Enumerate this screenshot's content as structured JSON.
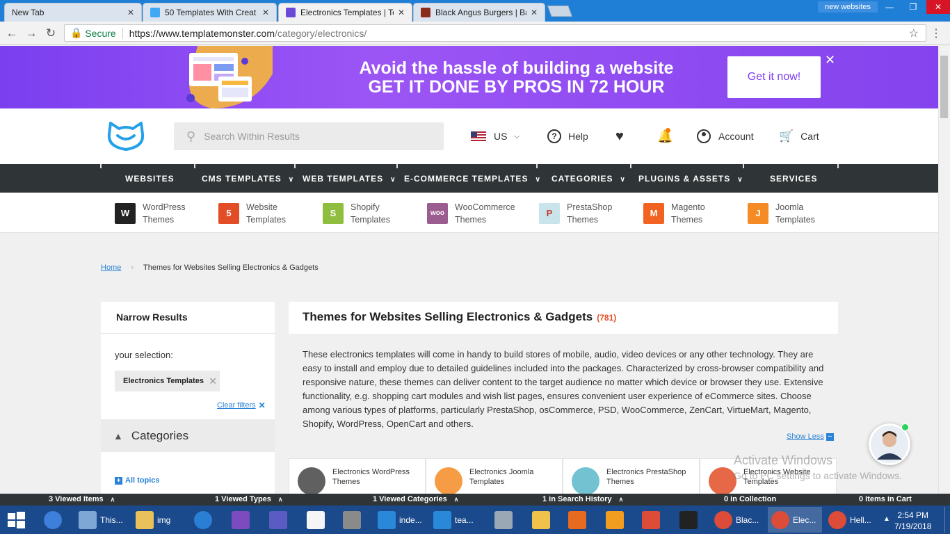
{
  "browser": {
    "tabs": [
      {
        "title": "New Tab",
        "active": false
      },
      {
        "title": "50 Templates With Creat",
        "active": false
      },
      {
        "title": "Electronics Templates | Te",
        "active": true
      },
      {
        "title": "Black Angus Burgers | Bac",
        "active": false
      }
    ],
    "profile": "new websites",
    "secure_label": "Secure",
    "url_host": "https://www.templatemonster.com",
    "url_path": "/category/electronics/"
  },
  "banner": {
    "line1": "Avoid the hassle of building a website",
    "line2": "GET IT DONE BY PROS IN 72 HOUR",
    "cta": "Get it now!"
  },
  "header": {
    "search_placeholder": "Search Within Results",
    "locale": "US",
    "help": "Help",
    "account": "Account",
    "cart": "Cart"
  },
  "nav": [
    {
      "label": "WEBSITES",
      "dropdown": false
    },
    {
      "label": "CMS TEMPLATES",
      "dropdown": true
    },
    {
      "label": "WEB TEMPLATES",
      "dropdown": true
    },
    {
      "label": "E-COMMERCE TEMPLATES",
      "dropdown": true
    },
    {
      "label": "CATEGORIES",
      "dropdown": true
    },
    {
      "label": "PLUGINS & ASSETS",
      "dropdown": true
    },
    {
      "label": "SERVICES",
      "dropdown": false
    }
  ],
  "platforms": [
    {
      "l1": "WordPress",
      "l2": "Themes",
      "icon": "wordpress-icon",
      "color": "#222222",
      "glyph": "W"
    },
    {
      "l1": "Website",
      "l2": "Templates",
      "icon": "html5-icon",
      "color": "#e34d26",
      "glyph": "5"
    },
    {
      "l1": "Shopify",
      "l2": "Templates",
      "icon": "shopify-icon",
      "color": "#8fbe3f",
      "glyph": "S"
    },
    {
      "l1": "WooCommerce",
      "l2": "Themes",
      "icon": "woocommerce-icon",
      "color": "#9b5c8f",
      "glyph": "woo"
    },
    {
      "l1": "PrestaShop",
      "l2": "Themes",
      "icon": "prestashop-icon",
      "color": "#c9e4ea",
      "glyph": "P"
    },
    {
      "l1": "Magento",
      "l2": "Themes",
      "icon": "magento-icon",
      "color": "#f26322",
      "glyph": "M"
    },
    {
      "l1": "Joomla",
      "l2": "Templates",
      "icon": "joomla-icon",
      "color": "#f48b24",
      "glyph": "J"
    }
  ],
  "breadcrumb": {
    "home": "Home",
    "current": "Themes for Websites Selling Electronics & Gadgets"
  },
  "sidebar": {
    "title": "Narrow Results",
    "selection_label": "your selection:",
    "chip": "Electronics Templates",
    "clear": "Clear filters",
    "categories": "Categories",
    "all_topics": "All topics"
  },
  "main": {
    "title": "Themes for Websites Selling Electronics & Gadgets",
    "count": "(781)",
    "description": "These electronics templates will come in handy to build stores of mobile, audio, video devices or any other technology. They are easy to install and employ due to detailed guidelines included into the packages. Characterized by cross-browser compatibility and responsive nature, these themes can deliver content to the target audience no matter which device or browser they use. Extensive functionality, e.g. shopping cart modules and wish list pages, ensures convenient user experience of eCommerce sites. Choose among various types of platforms, particularly PrestaShop, osCommerce, PSD, WooCommerce, ZenCart, VirtueMart, Magento, Shopify, WordPress, OpenCart and others.",
    "show_less": "Show Less",
    "cards": [
      {
        "l1": "Electronics WordPress",
        "l2": "Themes",
        "color": "#444444"
      },
      {
        "l1": "Electronics Joomla",
        "l2": "Templates",
        "color": "#f48b24"
      },
      {
        "l1": "Electronics PrestaShop",
        "l2": "Themes",
        "color": "#59b7c9"
      },
      {
        "l1": "Electronics Website",
        "l2": "Templates",
        "color": "#e34d26"
      }
    ]
  },
  "watermark": {
    "line1": "Activate Windows",
    "line2": "Go to PC settings to activate Windows."
  },
  "bottom_bar": [
    "3 Viewed Items",
    "1 Viewed Types",
    "1 Viewed Categories",
    "1 in Search History",
    "0 in Collection",
    "0 Items in Cart"
  ],
  "taskbar": {
    "items": [
      {
        "label": "",
        "color": "#3d7fd9"
      },
      {
        "label": "This...",
        "color": "#7fa7d6"
      },
      {
        "label": "img",
        "color": "#e8c15a"
      },
      {
        "label": "",
        "color": "#2a7fd4"
      },
      {
        "label": "",
        "color": "#7b4bbf"
      },
      {
        "label": "",
        "color": "#5b5bc4"
      },
      {
        "label": "",
        "color": "#f5f5f5"
      },
      {
        "label": "",
        "color": "#8a8a8a"
      },
      {
        "label": "inde...",
        "color": "#2a88d8"
      },
      {
        "label": "tea...",
        "color": "#2a88d8"
      },
      {
        "label": "",
        "color": "#9aa7b5"
      },
      {
        "label": "",
        "color": "#f0c24b"
      },
      {
        "label": "",
        "color": "#e66a1f"
      },
      {
        "label": "",
        "color": "#f29d1f"
      },
      {
        "label": "",
        "color": "#dd4b39"
      },
      {
        "label": "",
        "color": "#222222"
      },
      {
        "label": "Blac...",
        "color": "#dd4b39"
      },
      {
        "label": "Elec...",
        "color": "#dd4b39"
      },
      {
        "label": "Hell...",
        "color": "#dd4b39"
      }
    ],
    "time": "2:54 PM",
    "date": "7/19/2018"
  }
}
